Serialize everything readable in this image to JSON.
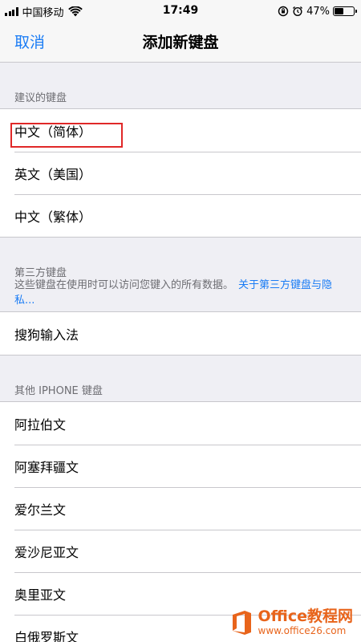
{
  "status_bar": {
    "carrier": "中国移动",
    "time": "17:49",
    "battery_text": "47%",
    "battery_level": 0.47,
    "signal_bars": 4
  },
  "nav": {
    "cancel_label": "取消",
    "title": "添加新键盘"
  },
  "sections": {
    "suggested": {
      "header": "建议的键盘",
      "items": [
        "中文（简体）",
        "英文（美国）",
        "中文（繁体）"
      ]
    },
    "third_party": {
      "header": "第三方键盘",
      "footer_text": "这些键盘在使用时可以访问您键入的所有数据。",
      "footer_link": "关于第三方键盘与隐私...",
      "items": [
        "搜狗输入法"
      ]
    },
    "other": {
      "header": "其他 IPHONE 键盘",
      "items": [
        "阿拉伯文",
        "阿塞拜疆文",
        "爱尔兰文",
        "爱沙尼亚文",
        "奥里亚文",
        "白俄罗斯文"
      ]
    }
  },
  "watermark": {
    "title": "Office教程网",
    "url": "www.office26.com"
  },
  "colors": {
    "accent": "#1a7cf5",
    "highlight": "#e02828",
    "watermark": "#e8641b"
  }
}
